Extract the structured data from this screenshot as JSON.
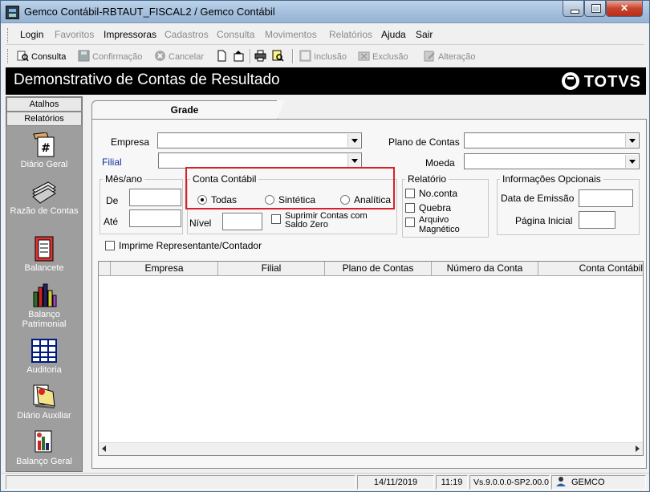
{
  "window": {
    "title": "Gemco Contábil-RBTAUT_FISCAL2 / Gemco Contábil"
  },
  "menu": {
    "items": [
      {
        "label": "Login",
        "enabled": true
      },
      {
        "label": "Favoritos",
        "enabled": false
      },
      {
        "label": "Impressoras",
        "enabled": true
      },
      {
        "label": "Cadastros",
        "enabled": false
      },
      {
        "label": "Consulta",
        "enabled": false
      },
      {
        "label": "Movimentos",
        "enabled": false
      },
      {
        "label": "Relatórios",
        "enabled": false
      },
      {
        "label": "Ajuda",
        "enabled": true
      },
      {
        "label": "Sair",
        "enabled": true
      }
    ]
  },
  "toolbar": {
    "consulta": "Consulta",
    "confirmacao": "Confirmação",
    "cancelar": "Cancelar",
    "inclusao": "Inclusão",
    "exclusao": "Exclusão",
    "alteracao": "Alteração"
  },
  "header": {
    "title": "Demonstrativo de Contas de Resultado",
    "brand": "TOTVS"
  },
  "sidebar": {
    "tab_atalhos": "Atalhos",
    "tab_relatorios": "Relatórios",
    "items": [
      {
        "label": "Diário Geral",
        "icon": "diario-geral-icon"
      },
      {
        "label": "Razão de Contas",
        "icon": "razao-icon"
      },
      {
        "label": "Balancete",
        "icon": "balancete-icon"
      },
      {
        "label": "Balanço Patrimonial",
        "icon": "balanco-patrimonial-icon"
      },
      {
        "label": "Auditoria",
        "icon": "auditoria-icon"
      },
      {
        "label": "Diário Auxiliar",
        "icon": "diario-auxiliar-icon"
      },
      {
        "label": "Balanço Geral",
        "icon": "balanco-geral-icon"
      }
    ]
  },
  "tab": {
    "label": "Grade"
  },
  "form": {
    "empresa_label": "Empresa",
    "empresa_value": "",
    "filial_label": "Filial",
    "filial_value": "",
    "plano_label": "Plano de Contas",
    "plano_value": "",
    "moeda_label": "Moeda",
    "moeda_value": "",
    "mes_ano": {
      "legend": "Mês/ano",
      "de_label": "De",
      "de_value": "",
      "ate_label": "Até",
      "ate_value": ""
    },
    "conta_contabil": {
      "legend": "Conta Contábil",
      "options": [
        "Todas",
        "Sintética",
        "Analítica"
      ],
      "selected": "Todas"
    },
    "nivel_label": "Nível",
    "nivel_value": "",
    "suprimir_label": "Suprimir Contas com Saldo Zero",
    "relatorio": {
      "legend": "Relatório",
      "options": [
        "No.conta",
        "Quebra",
        "Arquivo Magnético"
      ]
    },
    "informacoes": {
      "legend": "Informações Opcionais",
      "data_label": "Data de Emissão",
      "data_value": "",
      "pagina_label": "Página Inicial",
      "pagina_value": ""
    },
    "imprime_label": "Imprime Representante/Contador"
  },
  "grid": {
    "columns": [
      "Empresa",
      "Filial",
      "Plano de Contas",
      "Número da Conta",
      "Conta Contábil"
    ]
  },
  "status": {
    "date": "14/11/2019",
    "time": "11:19",
    "version": "Vs.9.0.0.0-SP2.00.0",
    "user": "GEMCO"
  },
  "colors": {
    "highlight": "#d8202a",
    "header_bg": "#000000",
    "sidebar_bg": "#9e9e9e"
  }
}
